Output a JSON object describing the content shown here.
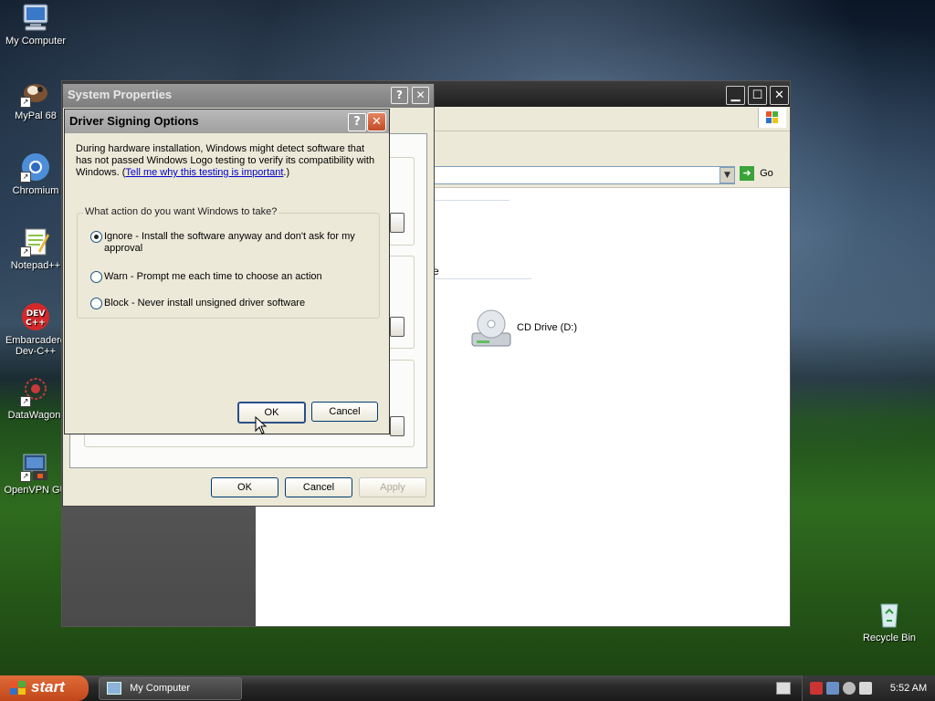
{
  "desktop": {
    "icons": [
      {
        "label": "My Computer"
      },
      {
        "label": "MyPal 68"
      },
      {
        "label": "Chromium"
      },
      {
        "label": "Notepad++"
      },
      {
        "label_line1": "Embarcadero",
        "label_line2": "Dev-C++"
      },
      {
        "label": "DataWagon."
      },
      {
        "label": "OpenVPN GU"
      },
      {
        "label": "Recycle Bin"
      }
    ]
  },
  "explorer": {
    "address_go": "Go",
    "content_partial_text": "e",
    "drive_label": "CD Drive (D:)"
  },
  "system_properties": {
    "title": "System Properties",
    "help_glyph": "?",
    "close_glyph": "✕",
    "ok": "OK",
    "cancel": "Cancel",
    "apply": "Apply"
  },
  "driver_signing": {
    "title": "Driver Signing Options",
    "help_glyph": "?",
    "close_glyph": "✕",
    "description": "During hardware installation, Windows might detect software that has not passed Windows Logo testing to verify its compatibility with Windows. (",
    "link": "Tell me why this testing is important",
    "description_end": ".)",
    "group_label": "What action do you want Windows to take?",
    "options": [
      {
        "label": "Ignore - Install the software anyway and don't ask for my approval",
        "selected": true
      },
      {
        "label": "Warn - Prompt me each time to choose an action",
        "selected": false
      },
      {
        "label": "Block - Never install unsigned driver software",
        "selected": false
      }
    ],
    "ok": "OK",
    "cancel": "Cancel"
  },
  "taskbar": {
    "start": "start",
    "task_item": "My Computer",
    "clock": "5:52 AM"
  }
}
